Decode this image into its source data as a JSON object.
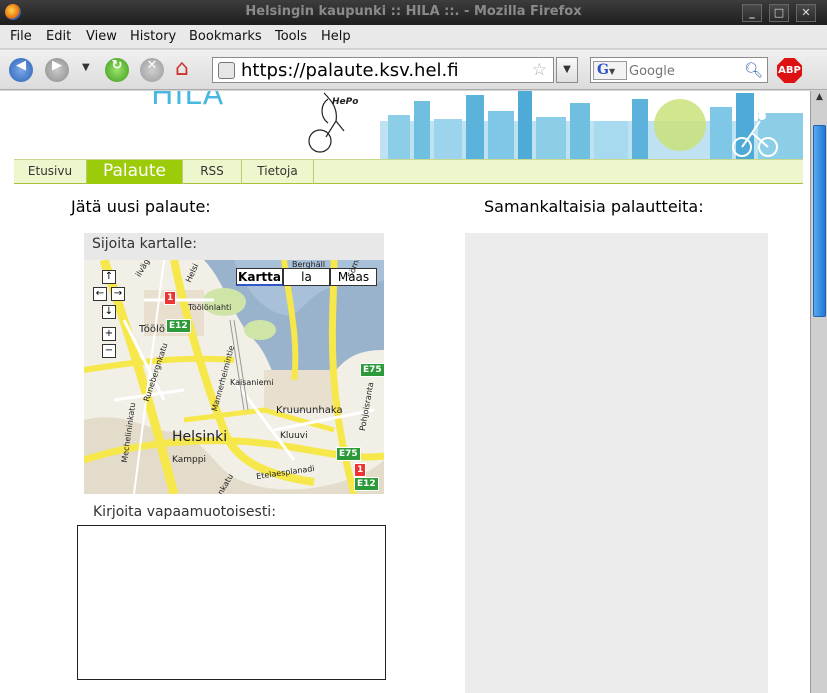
{
  "window": {
    "title": "Helsingin kaupunki :: HILA ::. - Mozilla Firefox"
  },
  "menu": [
    "File",
    "Edit",
    "View",
    "History",
    "Bookmarks",
    "Tools",
    "Help"
  ],
  "toolbar": {
    "url": "https://palaute.ksv.hel.fi",
    "search_engine": "G",
    "search_placeholder": "Google",
    "abp_label": "ABP"
  },
  "site": {
    "logo": "HILA",
    "banner_tag": "HePo",
    "tabs": [
      {
        "label": "Etusivu",
        "active": false
      },
      {
        "label": "Palaute",
        "active": true
      },
      {
        "label": "RSS",
        "active": false
      },
      {
        "label": "Tietoja",
        "active": false
      }
    ]
  },
  "form": {
    "heading": "Jätä uusi palaute:",
    "map_label": "Sijoita kartalle:",
    "free_label": "Kirjoita vapaamuotoisesti:",
    "free_text_value": ""
  },
  "map": {
    "types": [
      "Kartta",
      "la",
      "Maas"
    ],
    "active_type": "Kartta",
    "controls": {
      "up": "↑",
      "left": "←",
      "right": "→",
      "down": "↓",
      "zoom_in": "+",
      "zoom_out": "−"
    },
    "places": [
      "Helsinki",
      "Töölö",
      "Töölönlahti",
      "Kaisaniemi",
      "Kruununhaka",
      "Kluuvi",
      "Kamppi",
      "Berghäll",
      "Sörnäisten",
      "Pohjoisranta",
      "Etelaesplanadi",
      "Mechelininkatu",
      "Runebergnkatu",
      "Mannerheimintie",
      "Helsi",
      "ilvägen",
      "nkatu"
    ],
    "shields": [
      "1",
      "E12",
      "E75",
      "E75",
      "1",
      "E12"
    ],
    "colors": {
      "road": "#f6e84a",
      "water": "#99b3cc",
      "land": "#f2efe6",
      "park": "#cfe5a8"
    }
  },
  "related": {
    "heading": "Samankaltaisia palautteita:"
  },
  "colors": {
    "accent": "#9ccb0a",
    "tabbar": "#eef6cd",
    "panel": "#ececec"
  }
}
